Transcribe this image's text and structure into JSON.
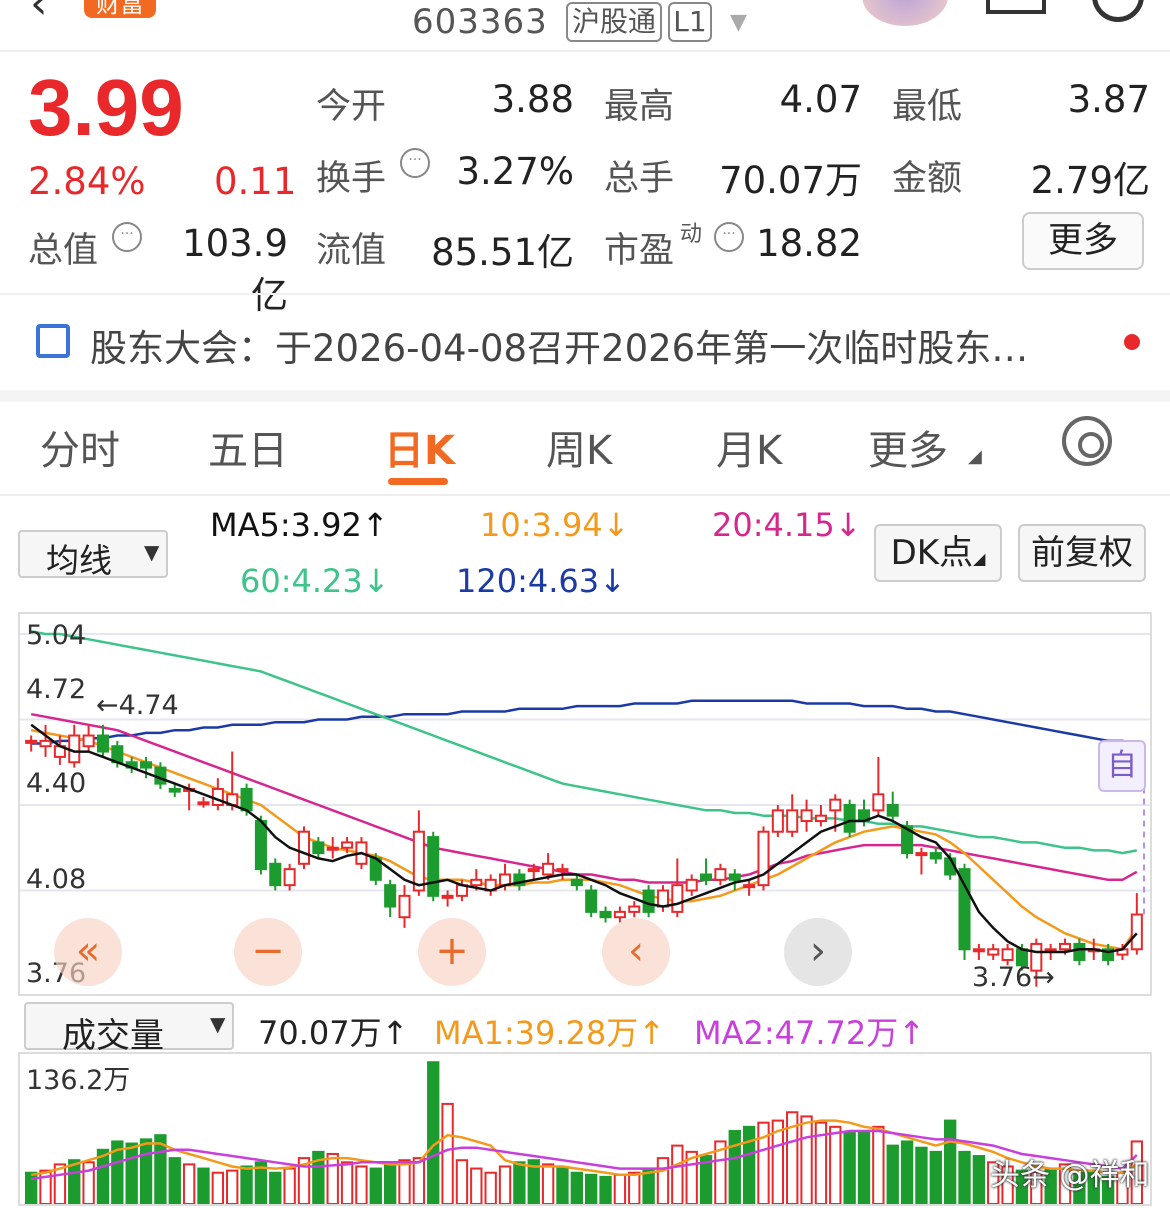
{
  "header": {
    "stock_code": "603363",
    "tags": [
      "沪股通",
      "L1"
    ],
    "logo_text": "财富"
  },
  "quote": {
    "price": "3.99",
    "change_pct": "2.84%",
    "change_amt": "0.11",
    "fields": {
      "open_label": "今开",
      "open_value": "3.88",
      "high_label": "最高",
      "high_value": "4.07",
      "low_label": "最低",
      "low_value": "3.87",
      "turnover_label": "换手",
      "turnover_value": "3.27%",
      "volume_label": "总手",
      "volume_value": "70.07万",
      "amount_label": "金额",
      "amount_value": "2.79亿",
      "mktcap_label": "总值",
      "mktcap_value": "103.9亿",
      "float_label": "流值",
      "float_value": "85.51亿",
      "pe_label": "市盈",
      "pe_sup": "动",
      "pe_value": "18.82"
    },
    "more_label": "更多",
    "colors": {
      "up": "#e8282b",
      "down": "#1c9b2e"
    }
  },
  "notice": {
    "text": "股东大会：于2026-04-08召开2026年第一次临时股东…"
  },
  "tabs": [
    {
      "label": "分时"
    },
    {
      "label": "五日"
    },
    {
      "label": "日K",
      "active": true
    },
    {
      "label": "周K"
    },
    {
      "label": "月K"
    },
    {
      "label": "更多"
    }
  ],
  "indicator_bar": {
    "selector": "均线",
    "ma5": "MA5:3.92↑",
    "ma10": "10:3.94↓",
    "ma20": "20:4.15↓",
    "ma60": "60:4.23↓",
    "ma120": "120:4.63↓",
    "dk_button": "DK点",
    "adjust_button": "前复权",
    "colors": {
      "ma5": "#111111",
      "ma10": "#f39a1c",
      "ma20": "#d6278f",
      "ma60": "#3ec48a",
      "ma120": "#1c3aa6"
    }
  },
  "kchart": {
    "y_labels": [
      "5.04",
      "4.72",
      "4.40",
      "4.08",
      "3.76"
    ],
    "max_annotation": "←4.74",
    "min_annotation": "3.76→",
    "auto_badge": "自",
    "nav_buttons": [
      "«",
      "−",
      "+",
      "‹",
      "›"
    ]
  },
  "volume": {
    "selector": "成交量",
    "vol": "70.07万↑",
    "ma1": "MA1:39.28万↑",
    "ma2": "MA2:47.72万↑",
    "y_label": "136.2万",
    "colors": {
      "ma1": "#f39a1c",
      "ma2": "#c93fdc"
    }
  },
  "watermark": "头条 @祥和",
  "chart_data": {
    "type": "candlestick",
    "ylim": [
      3.76,
      5.04
    ],
    "candles": [
      {
        "o": 4.64,
        "c": 4.64,
        "h": 4.66,
        "l": 4.6
      },
      {
        "o": 4.62,
        "c": 4.64,
        "h": 4.7,
        "l": 4.58
      },
      {
        "o": 4.58,
        "c": 4.62,
        "h": 4.66,
        "l": 4.55
      },
      {
        "o": 4.56,
        "c": 4.66,
        "h": 4.7,
        "l": 4.54
      },
      {
        "o": 4.62,
        "c": 4.66,
        "h": 4.7,
        "l": 4.6
      },
      {
        "o": 4.66,
        "c": 4.6,
        "h": 4.7,
        "l": 4.58
      },
      {
        "o": 4.62,
        "c": 4.56,
        "h": 4.64,
        "l": 4.54
      },
      {
        "o": 4.56,
        "c": 4.54,
        "h": 4.58,
        "l": 4.52
      },
      {
        "o": 4.56,
        "c": 4.54,
        "h": 4.58,
        "l": 4.5
      },
      {
        "o": 4.54,
        "c": 4.48,
        "h": 4.56,
        "l": 4.46
      },
      {
        "o": 4.46,
        "c": 4.45,
        "h": 4.48,
        "l": 4.43
      },
      {
        "o": 4.46,
        "c": 4.46,
        "h": 4.48,
        "l": 4.38
      },
      {
        "o": 4.41,
        "c": 4.41,
        "h": 4.43,
        "l": 4.39
      },
      {
        "o": 4.4,
        "c": 4.46,
        "h": 4.5,
        "l": 4.38
      },
      {
        "o": 4.4,
        "c": 4.44,
        "h": 4.6,
        "l": 4.38
      },
      {
        "o": 4.46,
        "c": 4.38,
        "h": 4.48,
        "l": 4.36
      },
      {
        "o": 4.34,
        "c": 4.16,
        "h": 4.36,
        "l": 4.14
      },
      {
        "o": 4.18,
        "c": 4.1,
        "h": 4.2,
        "l": 4.08
      },
      {
        "o": 4.1,
        "c": 4.16,
        "h": 4.18,
        "l": 4.08
      },
      {
        "o": 4.18,
        "c": 4.3,
        "h": 4.32,
        "l": 4.16
      },
      {
        "o": 4.26,
        "c": 4.22,
        "h": 4.28,
        "l": 4.2
      },
      {
        "o": 4.24,
        "c": 4.24,
        "h": 4.28,
        "l": 4.2
      },
      {
        "o": 4.24,
        "c": 4.26,
        "h": 4.28,
        "l": 4.22
      },
      {
        "o": 4.18,
        "c": 4.26,
        "h": 4.28,
        "l": 4.16
      },
      {
        "o": 4.2,
        "c": 4.12,
        "h": 4.22,
        "l": 4.1
      },
      {
        "o": 4.1,
        "c": 4.02,
        "h": 4.12,
        "l": 3.98
      },
      {
        "o": 3.98,
        "c": 4.06,
        "h": 4.1,
        "l": 3.94
      },
      {
        "o": 4.08,
        "c": 4.3,
        "h": 4.38,
        "l": 4.06
      },
      {
        "o": 4.28,
        "c": 4.06,
        "h": 4.3,
        "l": 4.04
      },
      {
        "o": 4.06,
        "c": 4.06,
        "h": 4.08,
        "l": 4.02
      },
      {
        "o": 4.06,
        "c": 4.1,
        "h": 4.12,
        "l": 4.04
      },
      {
        "o": 4.1,
        "c": 4.12,
        "h": 4.16,
        "l": 4.08
      },
      {
        "o": 4.08,
        "c": 4.12,
        "h": 4.14,
        "l": 4.06
      },
      {
        "o": 4.1,
        "c": 4.14,
        "h": 4.18,
        "l": 4.08
      },
      {
        "o": 4.14,
        "c": 4.1,
        "h": 4.16,
        "l": 4.08
      },
      {
        "o": 4.16,
        "c": 4.16,
        "h": 4.18,
        "l": 4.12
      },
      {
        "o": 4.14,
        "c": 4.18,
        "h": 4.22,
        "l": 4.12
      },
      {
        "o": 4.16,
        "c": 4.16,
        "h": 4.18,
        "l": 4.12
      },
      {
        "o": 4.12,
        "c": 4.1,
        "h": 4.14,
        "l": 4.08
      },
      {
        "o": 4.08,
        "c": 4.0,
        "h": 4.1,
        "l": 3.98
      },
      {
        "o": 4.0,
        "c": 3.98,
        "h": 4.02,
        "l": 3.96
      },
      {
        "o": 3.98,
        "c": 4.0,
        "h": 4.02,
        "l": 3.96
      },
      {
        "o": 4.0,
        "c": 4.02,
        "h": 4.04,
        "l": 3.98
      },
      {
        "o": 4.08,
        "c": 4.0,
        "h": 4.1,
        "l": 3.98
      },
      {
        "o": 4.02,
        "c": 4.08,
        "h": 4.1,
        "l": 4.0
      },
      {
        "o": 4.0,
        "c": 4.1,
        "h": 4.2,
        "l": 3.98
      },
      {
        "o": 4.08,
        "c": 4.12,
        "h": 4.14,
        "l": 4.06
      },
      {
        "o": 4.14,
        "c": 4.12,
        "h": 4.2,
        "l": 4.1
      },
      {
        "o": 4.12,
        "c": 4.16,
        "h": 4.18,
        "l": 4.1
      },
      {
        "o": 4.14,
        "c": 4.12,
        "h": 4.16,
        "l": 4.08
      },
      {
        "o": 4.1,
        "c": 4.1,
        "h": 4.12,
        "l": 4.06
      },
      {
        "o": 4.1,
        "c": 4.3,
        "h": 4.32,
        "l": 4.08
      },
      {
        "o": 4.3,
        "c": 4.38,
        "h": 4.4,
        "l": 4.28
      },
      {
        "o": 4.3,
        "c": 4.38,
        "h": 4.44,
        "l": 4.28
      },
      {
        "o": 4.34,
        "c": 4.38,
        "h": 4.42,
        "l": 4.3
      },
      {
        "o": 4.34,
        "c": 4.36,
        "h": 4.4,
        "l": 4.32
      },
      {
        "o": 4.38,
        "c": 4.42,
        "h": 4.44,
        "l": 4.3
      },
      {
        "o": 4.4,
        "c": 4.3,
        "h": 4.42,
        "l": 4.28
      },
      {
        "o": 4.38,
        "c": 4.34,
        "h": 4.42,
        "l": 4.32
      },
      {
        "o": 4.38,
        "c": 4.44,
        "h": 4.58,
        "l": 4.36
      },
      {
        "o": 4.4,
        "c": 4.36,
        "h": 4.45,
        "l": 4.34
      },
      {
        "o": 4.32,
        "c": 4.22,
        "h": 4.34,
        "l": 4.2
      },
      {
        "o": 4.22,
        "c": 4.22,
        "h": 4.24,
        "l": 4.14
      },
      {
        "o": 4.22,
        "c": 4.2,
        "h": 4.24,
        "l": 4.18
      },
      {
        "o": 4.2,
        "c": 4.14,
        "h": 4.22,
        "l": 4.12
      },
      {
        "o": 4.16,
        "c": 3.86,
        "h": 4.18,
        "l": 3.82
      },
      {
        "o": 3.86,
        "c": 3.86,
        "h": 3.88,
        "l": 3.82
      },
      {
        "o": 3.84,
        "c": 3.86,
        "h": 3.88,
        "l": 3.82
      },
      {
        "o": 3.82,
        "c": 3.86,
        "h": 3.88,
        "l": 3.8
      },
      {
        "o": 3.86,
        "c": 3.8,
        "h": 3.88,
        "l": 3.78
      },
      {
        "o": 3.78,
        "c": 3.88,
        "h": 3.9,
        "l": 3.72
      },
      {
        "o": 3.86,
        "c": 3.86,
        "h": 3.88,
        "l": 3.82
      },
      {
        "o": 3.86,
        "c": 3.88,
        "h": 3.9,
        "l": 3.84
      },
      {
        "o": 3.88,
        "c": 3.82,
        "h": 3.9,
        "l": 3.8
      },
      {
        "o": 3.86,
        "c": 3.86,
        "h": 3.9,
        "l": 3.82
      },
      {
        "o": 3.86,
        "c": 3.82,
        "h": 3.88,
        "l": 3.8
      },
      {
        "o": 3.84,
        "c": 3.86,
        "h": 3.88,
        "l": 3.82
      },
      {
        "o": 3.86,
        "c": 3.99,
        "h": 4.07,
        "l": 3.84
      }
    ],
    "ma5": [
      4.7,
      4.66,
      4.62,
      4.6,
      4.6,
      4.58,
      4.56,
      4.54,
      4.52,
      4.5,
      4.48,
      4.46,
      4.44,
      4.42,
      4.4,
      4.38,
      4.34,
      4.28,
      4.24,
      4.22,
      4.2,
      4.19,
      4.21,
      4.22,
      4.2,
      4.16,
      4.12,
      4.1,
      4.11,
      4.12,
      4.1,
      4.09,
      4.08,
      4.1,
      4.11,
      4.12,
      4.13,
      4.14,
      4.14,
      4.12,
      4.1,
      4.07,
      4.05,
      4.03,
      4.02,
      4.03,
      4.05,
      4.07,
      4.09,
      4.11,
      4.12,
      4.14,
      4.18,
      4.22,
      4.26,
      4.3,
      4.32,
      4.34,
      4.34,
      4.36,
      4.34,
      4.31,
      4.28,
      4.26,
      4.2,
      4.1,
      4.0,
      3.94,
      3.89,
      3.86,
      3.85,
      3.85,
      3.85,
      3.86,
      3.86,
      3.85,
      3.86,
      3.92
    ],
    "ma10": [
      4.68,
      4.67,
      4.66,
      4.65,
      4.64,
      4.62,
      4.6,
      4.58,
      4.56,
      4.54,
      4.52,
      4.5,
      4.48,
      4.46,
      4.44,
      4.42,
      4.4,
      4.36,
      4.32,
      4.28,
      4.26,
      4.24,
      4.23,
      4.22,
      4.21,
      4.19,
      4.16,
      4.13,
      4.12,
      4.12,
      4.12,
      4.11,
      4.1,
      4.1,
      4.1,
      4.11,
      4.11,
      4.12,
      4.12,
      4.12,
      4.11,
      4.1,
      4.08,
      4.06,
      4.05,
      4.04,
      4.04,
      4.05,
      4.06,
      4.08,
      4.1,
      4.12,
      4.14,
      4.17,
      4.2,
      4.23,
      4.26,
      4.28,
      4.3,
      4.31,
      4.32,
      4.31,
      4.3,
      4.29,
      4.26,
      4.22,
      4.17,
      4.12,
      4.07,
      4.02,
      3.98,
      3.95,
      3.92,
      3.9,
      3.88,
      3.87,
      3.86,
      3.94
    ],
    "ma20": [
      4.74,
      4.73,
      4.72,
      4.71,
      4.7,
      4.69,
      4.68,
      4.66,
      4.64,
      4.62,
      4.6,
      4.58,
      4.56,
      4.54,
      4.52,
      4.5,
      4.48,
      4.46,
      4.44,
      4.42,
      4.4,
      4.38,
      4.36,
      4.34,
      4.32,
      4.3,
      4.28,
      4.26,
      4.24,
      4.23,
      4.22,
      4.21,
      4.2,
      4.19,
      4.18,
      4.17,
      4.16,
      4.15,
      4.14,
      4.14,
      4.13,
      4.12,
      4.12,
      4.11,
      4.11,
      4.11,
      4.11,
      4.12,
      4.12,
      4.13,
      4.14,
      4.16,
      4.18,
      4.19,
      4.21,
      4.22,
      4.23,
      4.24,
      4.25,
      4.25,
      4.25,
      4.25,
      4.25,
      4.24,
      4.23,
      4.22,
      4.21,
      4.2,
      4.19,
      4.18,
      4.17,
      4.16,
      4.15,
      4.14,
      4.13,
      4.12,
      4.12,
      4.15
    ],
    "ma60": [
      5.05,
      5.04,
      5.04,
      5.03,
      5.02,
      5.01,
      5.0,
      4.99,
      4.98,
      4.97,
      4.96,
      4.95,
      4.94,
      4.93,
      4.92,
      4.91,
      4.9,
      4.88,
      4.86,
      4.84,
      4.82,
      4.8,
      4.78,
      4.76,
      4.74,
      4.72,
      4.7,
      4.68,
      4.66,
      4.64,
      4.62,
      4.6,
      4.58,
      4.56,
      4.54,
      4.52,
      4.5,
      4.48,
      4.47,
      4.46,
      4.45,
      4.44,
      4.43,
      4.42,
      4.41,
      4.4,
      4.39,
      4.38,
      4.38,
      4.37,
      4.37,
      4.36,
      4.36,
      4.36,
      4.35,
      4.35,
      4.35,
      4.34,
      4.34,
      4.33,
      4.33,
      4.32,
      4.32,
      4.31,
      4.3,
      4.29,
      4.28,
      4.28,
      4.27,
      4.26,
      4.26,
      4.25,
      4.24,
      4.24,
      4.23,
      4.23,
      4.22,
      4.23
    ],
    "ma120": [
      4.63,
      4.63,
      4.64,
      4.64,
      4.65,
      4.65,
      4.66,
      4.66,
      4.67,
      4.67,
      4.68,
      4.68,
      4.69,
      4.69,
      4.7,
      4.7,
      4.7,
      4.71,
      4.71,
      4.71,
      4.72,
      4.72,
      4.72,
      4.73,
      4.73,
      4.73,
      4.74,
      4.74,
      4.74,
      4.74,
      4.75,
      4.75,
      4.75,
      4.75,
      4.76,
      4.76,
      4.76,
      4.76,
      4.77,
      4.77,
      4.77,
      4.77,
      4.78,
      4.78,
      4.78,
      4.78,
      4.79,
      4.79,
      4.79,
      4.79,
      4.79,
      4.79,
      4.79,
      4.79,
      4.78,
      4.78,
      4.78,
      4.78,
      4.77,
      4.77,
      4.77,
      4.76,
      4.76,
      4.75,
      4.75,
      4.74,
      4.73,
      4.72,
      4.71,
      4.7,
      4.69,
      4.68,
      4.67,
      4.66,
      4.65,
      4.64,
      4.64,
      4.63
    ],
    "volume_ylim": [
      0,
      136.2
    ],
    "volumes": [
      30,
      32,
      38,
      42,
      40,
      52,
      60,
      58,
      62,
      66,
      44,
      38,
      34,
      30,
      32,
      36,
      40,
      30,
      34,
      44,
      50,
      48,
      40,
      36,
      34,
      38,
      42,
      44,
      136,
      96,
      42,
      34,
      30,
      36,
      40,
      42,
      38,
      34,
      30,
      28,
      26,
      28,
      30,
      34,
      44,
      56,
      50,
      46,
      60,
      70,
      74,
      78,
      80,
      88,
      84,
      78,
      74,
      68,
      70,
      74,
      56,
      60,
      54,
      50,
      80,
      50,
      46,
      40,
      36,
      32,
      30,
      34,
      38,
      30,
      30,
      26,
      30,
      60
    ],
    "vol_up": [
      false,
      true,
      true,
      false,
      true,
      false,
      false,
      false,
      false,
      false,
      false,
      true,
      false,
      true,
      true,
      false,
      false,
      false,
      true,
      true,
      false,
      true,
      true,
      true,
      false,
      false,
      true,
      true,
      false,
      true,
      true,
      true,
      true,
      true,
      false,
      false,
      true,
      false,
      false,
      false,
      false,
      true,
      true,
      false,
      true,
      true,
      true,
      false,
      true,
      false,
      false,
      true,
      true,
      true,
      true,
      true,
      true,
      false,
      false,
      true,
      false,
      false,
      false,
      false,
      false,
      false,
      false,
      true,
      true,
      false,
      true,
      false,
      true,
      false,
      false,
      false,
      true,
      true
    ],
    "vol_ma1": [
      28,
      30,
      34,
      38,
      42,
      46,
      52,
      54,
      58,
      58,
      52,
      48,
      44,
      40,
      36,
      34,
      35,
      34,
      35,
      38,
      42,
      44,
      44,
      42,
      40,
      38,
      38,
      40,
      56,
      66,
      64,
      60,
      56,
      42,
      38,
      36,
      36,
      36,
      34,
      32,
      30,
      28,
      28,
      30,
      32,
      38,
      44,
      48,
      52,
      56,
      60,
      64,
      70,
      74,
      78,
      80,
      80,
      78,
      74,
      72,
      68,
      64,
      60,
      56,
      60,
      58,
      54,
      50,
      44,
      40,
      36,
      34,
      34,
      32,
      32,
      30,
      30,
      38
    ],
    "vol_ma2": [
      24,
      26,
      28,
      30,
      32,
      36,
      40,
      44,
      48,
      50,
      52,
      52,
      50,
      48,
      46,
      44,
      42,
      40,
      38,
      36,
      36,
      37,
      38,
      40,
      40,
      40,
      40,
      40,
      46,
      52,
      54,
      54,
      52,
      50,
      48,
      46,
      44,
      42,
      40,
      38,
      36,
      34,
      34,
      34,
      34,
      36,
      38,
      40,
      42,
      44,
      48,
      52,
      56,
      60,
      64,
      66,
      68,
      70,
      70,
      70,
      68,
      66,
      64,
      62,
      62,
      60,
      58,
      56,
      52,
      48,
      46,
      44,
      42,
      40,
      38,
      36,
      34,
      47
    ]
  }
}
